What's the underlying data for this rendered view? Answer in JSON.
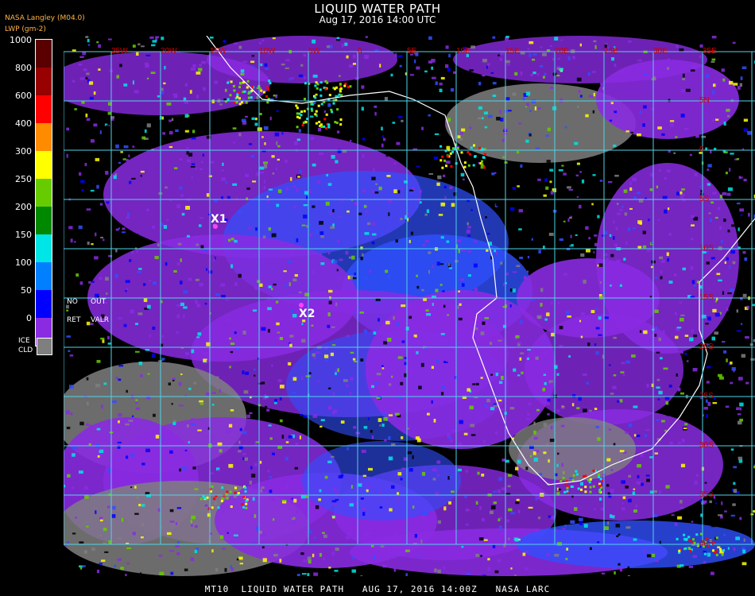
{
  "header": {
    "title": "LIQUID WATER PATH",
    "subtitle": "Aug 17, 2016 14:00 UTC",
    "provider": "NASA Langley (M04.0)",
    "units": "LWP (gm-2)"
  },
  "legend": {
    "ticks": [
      "1000",
      "800",
      "600",
      "400",
      "300",
      "250",
      "200",
      "150",
      "100",
      "50",
      "0"
    ],
    "colors": [
      "#5a0000",
      "#990000",
      "#ff0000",
      "#ff8c00",
      "#ffff00",
      "#66cc00",
      "#008800",
      "#00e5e5",
      "#0080ff",
      "#0000ff",
      "#8a2be2"
    ],
    "no_retrieval": {
      "line1a": "NO",
      "line1b": "OUT",
      "line2a": "RET",
      "line2b": "VALR"
    },
    "ice_cloud": {
      "line1": "ICE",
      "line2": "CLD",
      "color": "#7f7f7f"
    }
  },
  "map": {
    "lon_labels": [
      "25W",
      "20W",
      "15W",
      "10W",
      "5W",
      "0",
      "5E",
      "10E",
      "15E",
      "20E",
      "25E",
      "30E",
      "35E"
    ],
    "lat_labels": [
      "5N",
      "0",
      "5S",
      "10S",
      "15S",
      "20S",
      "25S",
      "30S",
      "35S",
      "40S"
    ],
    "markers": [
      {
        "label": "X1"
      },
      {
        "label": "X2"
      }
    ]
  },
  "footer": {
    "text": "MT10  LIQUID WATER PATH   AUG 17, 2016 14:00Z   NASA LARC"
  }
}
